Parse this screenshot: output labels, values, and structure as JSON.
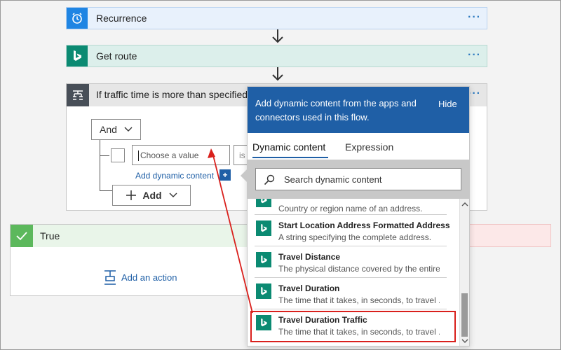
{
  "steps": {
    "recurrence": {
      "title": "Recurrence",
      "menu": "···"
    },
    "get_route": {
      "title": "Get route",
      "menu": "···"
    },
    "condition": {
      "title": "If traffic time is more than specified",
      "menu": "···"
    }
  },
  "condition_editor": {
    "operator": "And",
    "value_placeholder": "Choose a value",
    "operator_placeholder": "is",
    "add_dynamic_link": "Add dynamic content",
    "add_button": "Add"
  },
  "branches": {
    "true": {
      "title": "True",
      "add_action": "Add an action"
    }
  },
  "dynamic_panel": {
    "header": "Add dynamic content from the apps and connectors used in this flow.",
    "hide": "Hide",
    "tabs": [
      "Dynamic content",
      "Expression"
    ],
    "active_tab": "Dynamic content",
    "search_placeholder": "Search dynamic content",
    "partial_item_desc": "Country or region name of an address.",
    "items": [
      {
        "name": "Start Location Address Formatted Address",
        "desc": "A string specifying the complete address."
      },
      {
        "name": "Travel Distance",
        "desc": "The physical distance covered by the entire"
      },
      {
        "name": "Travel Duration",
        "desc": "The time that it takes, in seconds, to travel ..."
      },
      {
        "name": "Travel Duration Traffic",
        "desc": "The time that it takes, in seconds, to travel ...",
        "highlighted": true
      }
    ]
  },
  "colors": {
    "recurrence_tile": "#1f85e3",
    "bing_tile": "#0b8a72",
    "condition_tile": "#484f58",
    "panel_header": "#1f5fa6",
    "true_tile": "#5cb85c",
    "highlight": "#d9201c"
  }
}
